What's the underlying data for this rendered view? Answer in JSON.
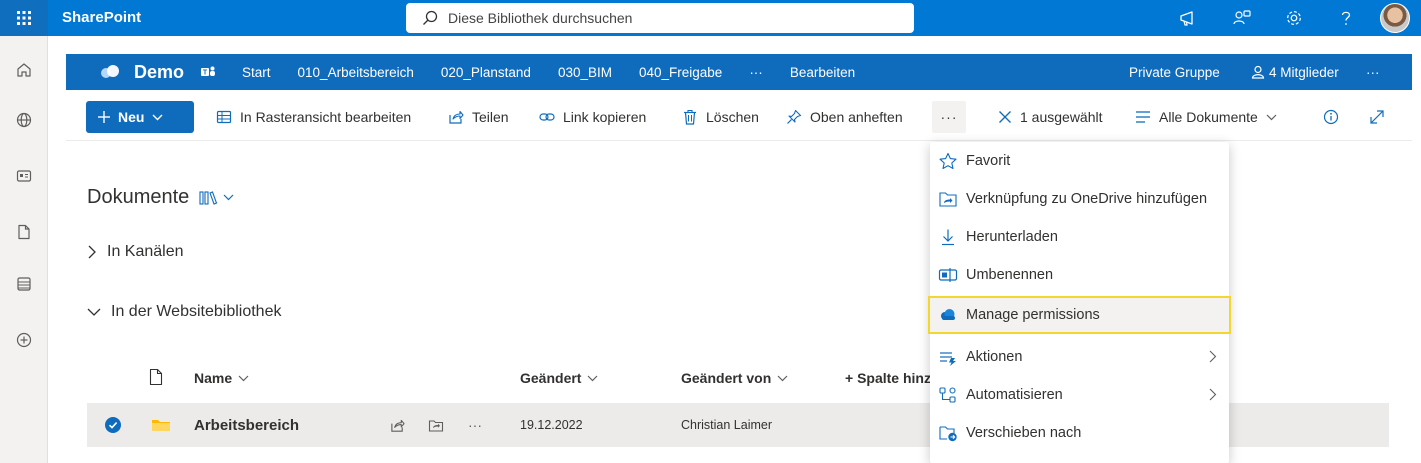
{
  "suite": {
    "brand": "SharePoint",
    "search_placeholder": "Diese Bibliothek durchsuchen",
    "icons": [
      "waffle-icon",
      "megaphone-icon",
      "people-icon",
      "settings-icon",
      "help-icon",
      "avatar"
    ],
    "accent": "#0078d4"
  },
  "rail": {
    "items": [
      "home-icon",
      "globe-icon",
      "news-icon",
      "file-icon",
      "list-icon",
      "add-icon"
    ]
  },
  "site": {
    "title": "Demo",
    "nav": [
      "Start",
      "010_Arbeitsbereich",
      "020_Planstand",
      "030_BIM",
      "040_Freigabe",
      "···",
      "Bearbeiten"
    ],
    "privacy": "Private Gruppe",
    "members": "4 Mitglieder",
    "more": "···"
  },
  "commands": {
    "new_label": "Neu",
    "grid_edit": "In Rasteransicht bearbeiten",
    "share": "Teilen",
    "copy_link": "Link kopieren",
    "delete": "Löschen",
    "pin": "Oben anheften",
    "more": "···",
    "selected": "1 ausgewählt",
    "view": "Alle Dokumente"
  },
  "library": {
    "title": "Dokumente",
    "sections": [
      "In Kanälen",
      "In der Websitebibliothek"
    ],
    "columns": {
      "name": "Name",
      "modified": "Geändert",
      "modified_by": "Geändert von",
      "add_column": "+ Spalte hinz"
    },
    "rows": [
      {
        "name": "Arbeitsbereich",
        "modified": "19.12.2022",
        "modified_by": "Christian Laimer",
        "more": "···"
      }
    ]
  },
  "menu": {
    "items": [
      {
        "label": "Favorit",
        "icon": "star-icon"
      },
      {
        "label": "Verknüpfung zu OneDrive hinzufügen",
        "icon": "onedrive-shortcut-icon"
      },
      {
        "label": "Herunterladen",
        "icon": "download-icon"
      },
      {
        "label": "Umbenennen",
        "icon": "rename-icon"
      },
      {
        "label": "Manage permissions",
        "icon": "cloud-icon",
        "highlighted": true
      },
      {
        "label": "Aktionen",
        "icon": "actions-icon",
        "submenu": true
      },
      {
        "label": "Automatisieren",
        "icon": "automate-icon",
        "submenu": true
      },
      {
        "label": "Verschieben nach",
        "icon": "move-icon"
      }
    ],
    "highlight_color": "#f2d72e"
  }
}
